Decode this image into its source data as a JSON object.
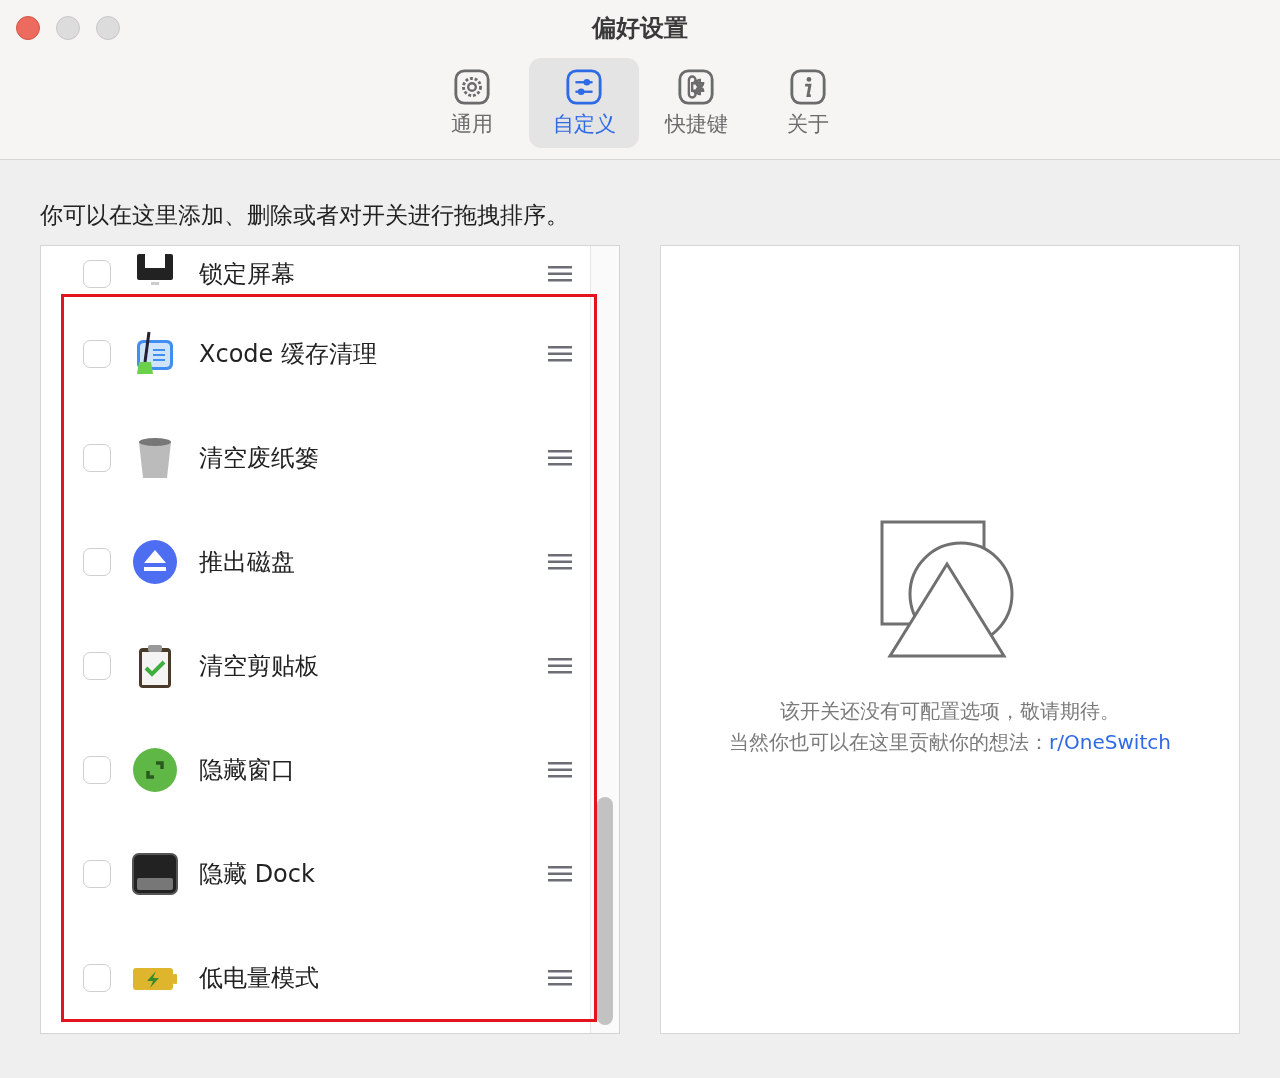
{
  "window": {
    "title": "偏好设置"
  },
  "tabs": [
    {
      "label": "通用",
      "kind": "general",
      "selected": false
    },
    {
      "label": "自定义",
      "kind": "custom",
      "selected": true
    },
    {
      "label": "快捷键",
      "kind": "shortcuts",
      "selected": false
    },
    {
      "label": "关于",
      "kind": "about",
      "selected": false
    }
  ],
  "instruction": "你可以在这里添加、删除或者对开关进行拖拽排序。",
  "switches": [
    {
      "name": "锁定屏幕",
      "kind": "lock",
      "checked": false
    },
    {
      "name": "Xcode 缓存清理",
      "kind": "xcode",
      "checked": false
    },
    {
      "name": "清空废纸篓",
      "kind": "trash",
      "checked": false
    },
    {
      "name": "推出磁盘",
      "kind": "eject",
      "checked": false
    },
    {
      "name": "清空剪贴板",
      "kind": "clipboard",
      "checked": false
    },
    {
      "name": "隐藏窗口",
      "kind": "window",
      "checked": false
    },
    {
      "name": "隐藏 Dock",
      "kind": "dock",
      "checked": false
    },
    {
      "name": "低电量模式",
      "kind": "battery",
      "checked": false
    }
  ],
  "detail": {
    "message": "该开关还没有可配置选项，敬请期待。",
    "prompt": "当然你也可以在这里贡献你的想法：",
    "link": "r/OneSwitch"
  }
}
